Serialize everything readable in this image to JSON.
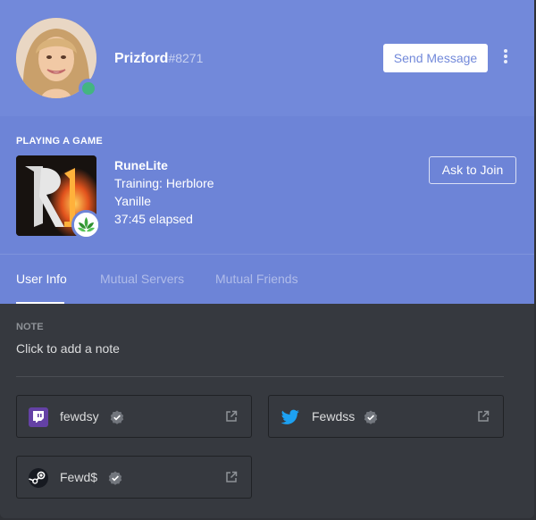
{
  "profile": {
    "username": "Prizford",
    "discriminator": "#8271",
    "status": "online",
    "send_message_label": "Send Message"
  },
  "activity": {
    "section_title": "PLAYING A GAME",
    "game_name": "RuneLite",
    "details": "Training: Herblore",
    "state": "Yanille",
    "elapsed": "37:45 elapsed",
    "join_label": "Ask to Join"
  },
  "tabs": [
    {
      "label": "User Info",
      "active": true
    },
    {
      "label": "Mutual Servers",
      "active": false
    },
    {
      "label": "Mutual Friends",
      "active": false
    }
  ],
  "note": {
    "label": "NOTE",
    "placeholder": "Click to add a note"
  },
  "connections": [
    {
      "service": "twitch",
      "icon": "twitch-icon",
      "name": "fewdsy",
      "verified": true,
      "color": "#6441a5"
    },
    {
      "service": "twitter",
      "icon": "twitter-icon",
      "name": "Fewdss",
      "verified": true,
      "color": "#1da1f2"
    },
    {
      "service": "steam",
      "icon": "steam-icon",
      "name": "Fewd$",
      "verified": true,
      "color": "#171a21"
    }
  ],
  "colors": {
    "blurple": "#7289da",
    "online": "#43b581",
    "background": "#36393f"
  }
}
